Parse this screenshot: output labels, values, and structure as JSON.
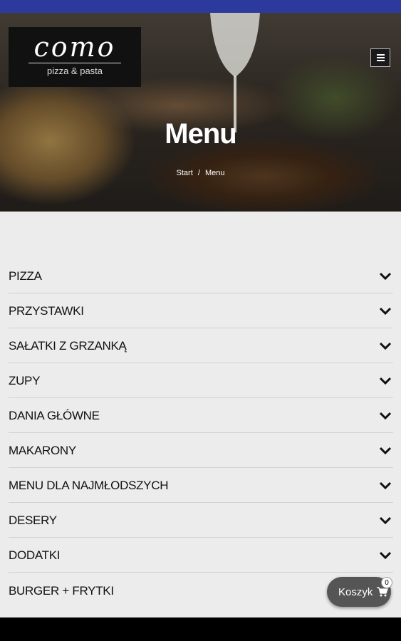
{
  "header": {
    "logo_title": "como",
    "logo_subtitle": "pizza & pasta",
    "menu_button_icon": "hamburger-menu-icon",
    "page_title": "Menu",
    "breadcrumb": {
      "home": "Start",
      "separator": "/",
      "current": "Menu"
    }
  },
  "menu": {
    "categories": [
      {
        "label": "PIZZA"
      },
      {
        "label": "PRZYSTAWKI"
      },
      {
        "label": "SAŁATKI Z GRZANKĄ"
      },
      {
        "label": "ZUPY"
      },
      {
        "label": "DANIA GŁÓWNE"
      },
      {
        "label": "MAKARONY"
      },
      {
        "label": "MENU DLA NAJMŁODSZYCH"
      },
      {
        "label": "DESERY"
      },
      {
        "label": "DODATKI"
      },
      {
        "label": "BURGER + FRYTKI"
      }
    ],
    "expand_icon": "chevron-down-icon"
  },
  "cart": {
    "label": "Koszyk",
    "count": "0",
    "icon": "cart-icon"
  },
  "colors": {
    "status_bar": "#2d3a9d",
    "content_bg": "#ececec",
    "cart_bg": "#555555",
    "logo_bg": "#111111"
  }
}
